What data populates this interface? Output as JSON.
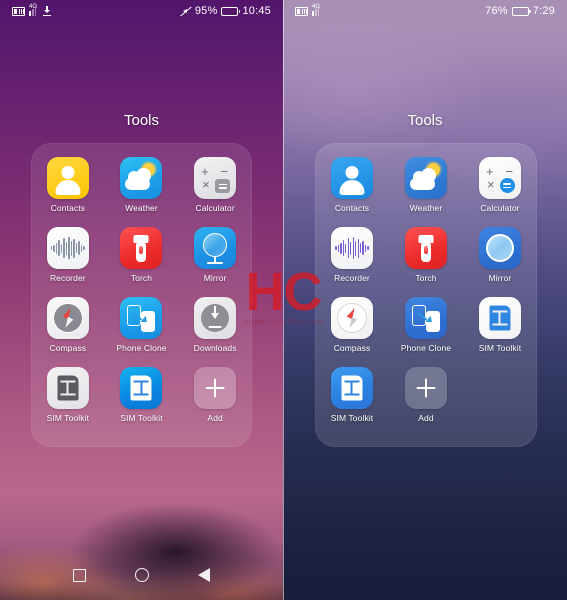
{
  "phones": [
    {
      "id": "left",
      "status": {
        "icons_left": [
          "voicemail-icon",
          "signal-4g-icon",
          "download-icon"
        ],
        "network_label": "4G",
        "mute_icon": "mute-icon",
        "battery_percent": "95%",
        "battery_level": 95,
        "time": "10:45"
      },
      "folder": {
        "title": "Tools",
        "apps": [
          {
            "label": "Contacts",
            "icon": "contacts-icon"
          },
          {
            "label": "Weather",
            "icon": "weather-icon"
          },
          {
            "label": "Calculator",
            "icon": "calculator-icon"
          },
          {
            "label": "Recorder",
            "icon": "recorder-icon"
          },
          {
            "label": "Torch",
            "icon": "torch-icon"
          },
          {
            "label": "Mirror",
            "icon": "mirror-icon"
          },
          {
            "label": "Compass",
            "icon": "compass-icon"
          },
          {
            "label": "Phone Clone",
            "icon": "phone-clone-icon"
          },
          {
            "label": "Downloads",
            "icon": "downloads-icon"
          },
          {
            "label": "SIM Toolkit",
            "icon": "sim-toolkit-grey-icon"
          },
          {
            "label": "SIM Toolkit",
            "icon": "sim-toolkit-blue-icon"
          },
          {
            "label": "Add",
            "icon": "add-icon"
          }
        ]
      },
      "navbar": {
        "recents_label": "Recents",
        "home_label": "Home",
        "back_label": "Back"
      }
    },
    {
      "id": "right",
      "status": {
        "icons_left": [
          "voicemail-icon",
          "signal-4g-icon"
        ],
        "network_label": "4G",
        "battery_percent": "76%",
        "battery_level": 76,
        "time": "7:29"
      },
      "folder": {
        "title": "Tools",
        "apps": [
          {
            "label": "Contacts",
            "icon": "contacts-icon"
          },
          {
            "label": "Weather",
            "icon": "weather-icon"
          },
          {
            "label": "Calculator",
            "icon": "calculator-icon"
          },
          {
            "label": "Recorder",
            "icon": "recorder-icon"
          },
          {
            "label": "Torch",
            "icon": "torch-icon"
          },
          {
            "label": "Mirror",
            "icon": "mirror-icon"
          },
          {
            "label": "Compass",
            "icon": "compass-icon"
          },
          {
            "label": "Phone Clone",
            "icon": "phone-clone-icon"
          },
          {
            "label": "SIM Toolkit",
            "icon": "sim-toolkit-white-icon"
          },
          {
            "label": "SIM Toolkit",
            "icon": "sim-toolkit-blue-icon"
          },
          {
            "label": "Add",
            "icon": "add-icon"
          }
        ]
      }
    }
  ],
  "watermark": {
    "text": "HC",
    "subtitle": "HUAWEICENTRAL.COM",
    "color": "#d61c26"
  },
  "colors": {
    "contacts_left": "#ffd740",
    "contacts_right": "#2f9fe8",
    "torch": "#ec2b2b",
    "weather": "#1e9fe8",
    "accent_blue": "#0a84e0"
  }
}
